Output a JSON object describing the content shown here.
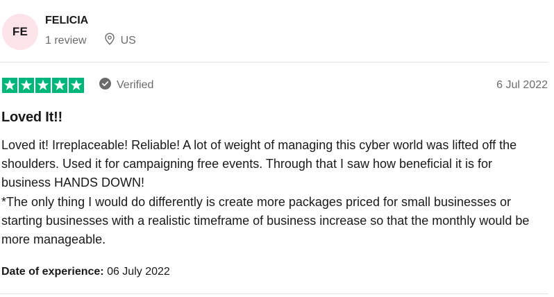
{
  "reviewer": {
    "initials": "FE",
    "name": "FELICIA",
    "review_count": "1 review",
    "country": "US",
    "avatar_color": "#fde3ea"
  },
  "review": {
    "rating": 5,
    "max_rating": 5,
    "star_color": "#00b67a",
    "verified_label": "Verified",
    "date": "6 Jul 2022",
    "title": "Loved It!!",
    "body": "Loved it! Irreplaceable! Reliable! A lot of weight of managing this cyber world was lifted off the shoulders. Used it for campaigning free events. Through that I saw how beneficial it is for business HANDS DOWN!\n*The only thing I would do differently is create more packages priced for small businesses or starting businesses with a realistic timeframe of business increase so that the monthly would be more manageable.",
    "experience_label": "Date of experience:",
    "experience_date": "06 July 2022"
  },
  "icons": {
    "location": "location-pin-icon",
    "verified": "verified-check-icon",
    "star": "star-icon"
  }
}
